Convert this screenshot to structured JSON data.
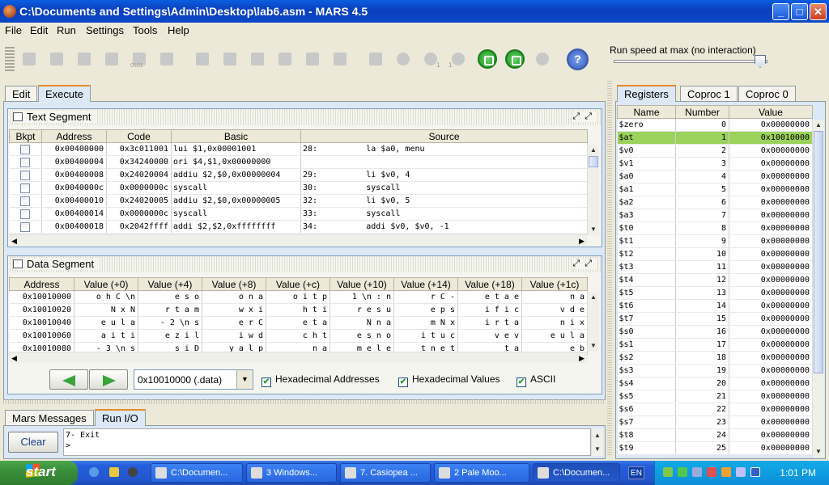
{
  "window": {
    "title": "C:\\Documents and Settings\\Admin\\Desktop\\lab6.asm  - MARS 4.5",
    "min": "_",
    "max": "□",
    "close": "✕"
  },
  "menu": [
    "File",
    "Edit",
    "Run",
    "Settings",
    "Tools",
    "Help"
  ],
  "toolbar": {
    "help": "?",
    "run_speed": "Run speed at max (no interaction)",
    "step_label": "0101",
    "sub1": "1",
    "sub2": "1"
  },
  "left_tabs": {
    "edit": "Edit",
    "execute": "Execute"
  },
  "text_segment": {
    "title": "Text Segment",
    "headers": [
      "Bkpt",
      "Address",
      "Code",
      "Basic",
      "Source"
    ],
    "rows": [
      {
        "address": "0x00400000",
        "code": "0x3c011001",
        "basic": "lui $1,0x00001001",
        "source": "28:          la $a0, menu"
      },
      {
        "address": "0x00400004",
        "code": "0x34240000",
        "basic": "ori $4,$1,0x00000000",
        "source": ""
      },
      {
        "address": "0x00400008",
        "code": "0x24020004",
        "basic": "addiu $2,$0,0x00000004",
        "source": "29:          li $v0, 4"
      },
      {
        "address": "0x0040000c",
        "code": "0x0000000c",
        "basic": "syscall",
        "source": "30:          syscall"
      },
      {
        "address": "0x00400010",
        "code": "0x24020005",
        "basic": "addiu $2,$0,0x00000005",
        "source": "32:          li $v0, 5"
      },
      {
        "address": "0x00400014",
        "code": "0x0000000c",
        "basic": "syscall",
        "source": "33:          syscall"
      },
      {
        "address": "0x00400018",
        "code": "0x2042ffff",
        "basic": "addi $2,$2,0xffffffff",
        "source": "34:          addi $v0, $v0, -1"
      }
    ]
  },
  "data_segment": {
    "title": "Data Segment",
    "headers": [
      "Address",
      "Value (+0)",
      "Value (+4)",
      "Value (+8)",
      "Value (+c)",
      "Value (+10)",
      "Value (+14)",
      "Value (+18)",
      "Value (+1c)"
    ],
    "rows": [
      {
        "address": "0x10010000",
        "values": [
          "o h C \\n",
          "e s o",
          "o n a",
          "o i t p",
          "1 \\n : n",
          "r C -",
          "e t a e",
          "n a"
        ]
      },
      {
        "address": "0x10010020",
        "values": [
          "N x N",
          "r t a m",
          "w x i",
          "h t i",
          "r e s u",
          "e p s",
          "i f i c",
          "v d e"
        ]
      },
      {
        "address": "0x10010040",
        "values": [
          "e u l a",
          "- 2 \\n s",
          "e r C",
          "e t a",
          "N n a",
          "m N x",
          "i r t a",
          "n i x"
        ]
      },
      {
        "address": "0x10010060",
        "values": [
          "a i t i",
          "e z i l",
          "i w d",
          "c h t",
          "e s n o",
          "i t u c",
          "v e v",
          "e u l a"
        ]
      },
      {
        "address": "0x10010080",
        "values": [
          "- 3 \\n s",
          "s i D",
          "y a l p",
          "n a",
          "m e l e",
          "t n e t",
          "t a",
          "e b"
        ]
      }
    ],
    "nav": {
      "address_select": "0x10010000 (.data)",
      "hex_addresses": "Hexadecimal Addresses",
      "hex_values": "Hexadecimal Values",
      "ascii": "ASCII"
    }
  },
  "bottom": {
    "tabs": [
      "Mars Messages",
      "Run I/O"
    ],
    "clear": "Clear",
    "console": [
      "7- Exit",
      ">"
    ]
  },
  "registers": {
    "tabs": [
      "Registers",
      "Coproc 1",
      "Coproc 0"
    ],
    "headers": [
      "Name",
      "Number",
      "Value"
    ],
    "rows": [
      {
        "name": "$zero",
        "number": "0",
        "value": "0x00000000"
      },
      {
        "name": "$at",
        "number": "1",
        "value": "0x10010000"
      },
      {
        "name": "$v0",
        "number": "2",
        "value": "0x00000000"
      },
      {
        "name": "$v1",
        "number": "3",
        "value": "0x00000000"
      },
      {
        "name": "$a0",
        "number": "4",
        "value": "0x00000000"
      },
      {
        "name": "$a1",
        "number": "5",
        "value": "0x00000000"
      },
      {
        "name": "$a2",
        "number": "6",
        "value": "0x00000000"
      },
      {
        "name": "$a3",
        "number": "7",
        "value": "0x00000000"
      },
      {
        "name": "$t0",
        "number": "8",
        "value": "0x00000000"
      },
      {
        "name": "$t1",
        "number": "9",
        "value": "0x00000000"
      },
      {
        "name": "$t2",
        "number": "10",
        "value": "0x00000000"
      },
      {
        "name": "$t3",
        "number": "11",
        "value": "0x00000000"
      },
      {
        "name": "$t4",
        "number": "12",
        "value": "0x00000000"
      },
      {
        "name": "$t5",
        "number": "13",
        "value": "0x00000000"
      },
      {
        "name": "$t6",
        "number": "14",
        "value": "0x00000000"
      },
      {
        "name": "$t7",
        "number": "15",
        "value": "0x00000000"
      },
      {
        "name": "$s0",
        "number": "16",
        "value": "0x00000000"
      },
      {
        "name": "$s1",
        "number": "17",
        "value": "0x00000000"
      },
      {
        "name": "$s2",
        "number": "18",
        "value": "0x00000000"
      },
      {
        "name": "$s3",
        "number": "19",
        "value": "0x00000000"
      },
      {
        "name": "$s4",
        "number": "20",
        "value": "0x00000000"
      },
      {
        "name": "$s5",
        "number": "21",
        "value": "0x00000000"
      },
      {
        "name": "$s6",
        "number": "22",
        "value": "0x00000000"
      },
      {
        "name": "$s7",
        "number": "23",
        "value": "0x00000000"
      },
      {
        "name": "$t8",
        "number": "24",
        "value": "0x00000000"
      },
      {
        "name": "$t9",
        "number": "25",
        "value": "0x00000000"
      }
    ],
    "highlight_color": "#9bd25c"
  },
  "taskbar": {
    "start": "start",
    "tasks": [
      "C:\\Documen...",
      "3 Windows...",
      "7. Casiopea ...",
      "2 Pale Moo...",
      "C:\\Documen..."
    ],
    "lang": "EN",
    "clock": "1:01 PM"
  },
  "colors": {
    "title_blue": "#0a49c8",
    "tab_accent": "#e68b2c",
    "run_green": "#179017",
    "taskbar_blue": "#245edb",
    "start_green": "#3a8f3a"
  }
}
